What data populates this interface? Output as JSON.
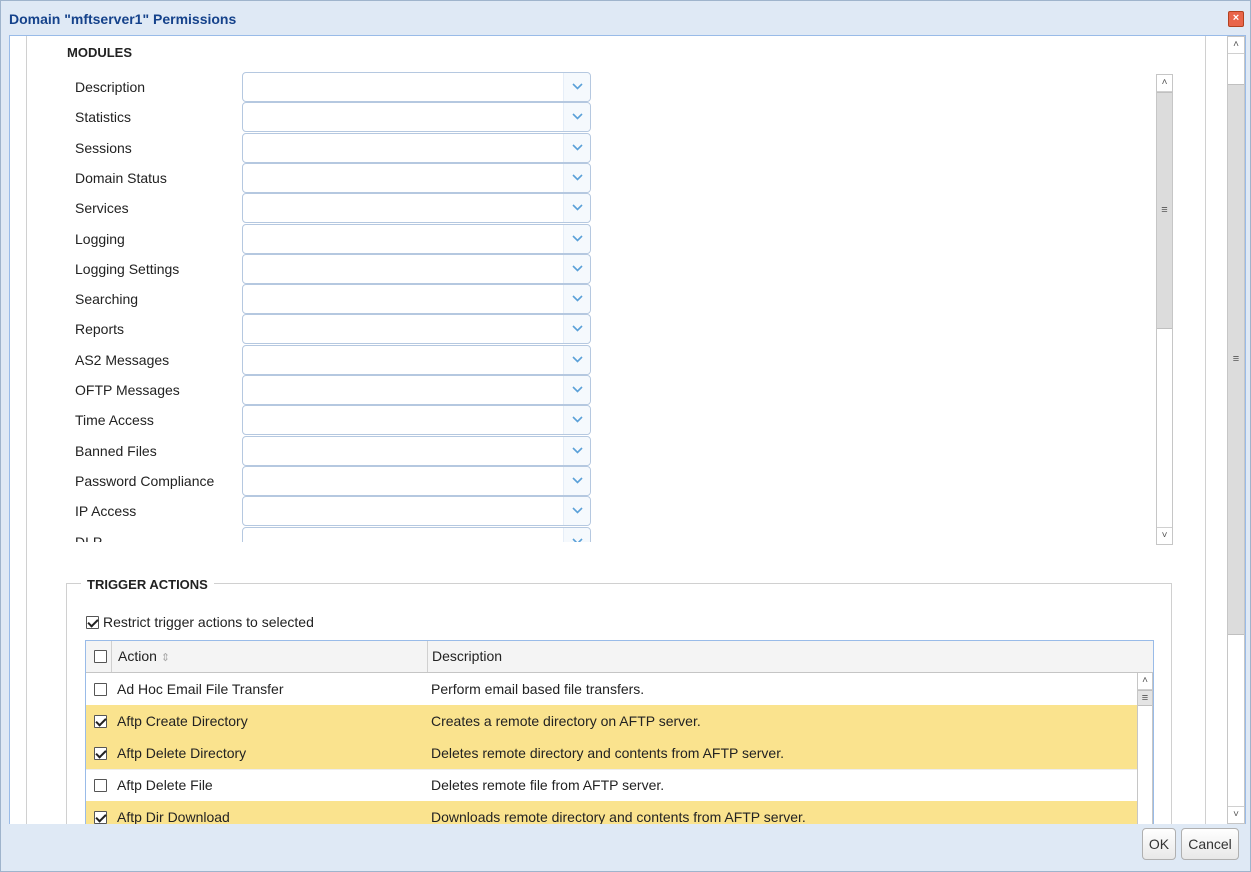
{
  "window": {
    "title": "Domain \"mftserver1\" Permissions",
    "close_glyph": "×"
  },
  "modules": {
    "heading": "MODULES",
    "items": [
      {
        "label": "Description",
        "value": ""
      },
      {
        "label": "Statistics",
        "value": ""
      },
      {
        "label": "Sessions",
        "value": ""
      },
      {
        "label": "Domain Status",
        "value": ""
      },
      {
        "label": "Services",
        "value": ""
      },
      {
        "label": "Logging",
        "value": ""
      },
      {
        "label": "Logging Settings",
        "value": ""
      },
      {
        "label": "Searching",
        "value": ""
      },
      {
        "label": "Reports",
        "value": ""
      },
      {
        "label": "AS2 Messages",
        "value": ""
      },
      {
        "label": "OFTP Messages",
        "value": ""
      },
      {
        "label": "Time Access",
        "value": ""
      },
      {
        "label": "Banned Files",
        "value": ""
      },
      {
        "label": "Password Compliance",
        "value": ""
      },
      {
        "label": "IP Access",
        "value": ""
      },
      {
        "label": "DLP",
        "value": ""
      }
    ]
  },
  "trigger_actions": {
    "heading": "TRIGGER ACTIONS",
    "restrict_label": "Restrict trigger actions to selected",
    "restrict_checked": true,
    "columns": {
      "action": "Action",
      "description": "Description"
    },
    "rows": [
      {
        "action": "Ad Hoc Email File Transfer",
        "description": "Perform email based file transfers.",
        "checked": false
      },
      {
        "action": "Aftp Create Directory",
        "description": "Creates a remote directory on AFTP server.",
        "checked": true
      },
      {
        "action": "Aftp Delete Directory",
        "description": "Deletes remote directory and contents from AFTP server.",
        "checked": true
      },
      {
        "action": "Aftp Delete File",
        "description": "Deletes remote file from AFTP server.",
        "checked": false
      },
      {
        "action": "Aftp Dir Download",
        "description": "Downloads remote directory and contents from AFTP server.",
        "checked": true
      }
    ]
  },
  "footer": {
    "ok_label": "OK",
    "cancel_label": "Cancel"
  },
  "colors": {
    "selected_row": "#fae38e",
    "title_text": "#15428b",
    "dropdown_arrow": "#5aa0d8"
  }
}
